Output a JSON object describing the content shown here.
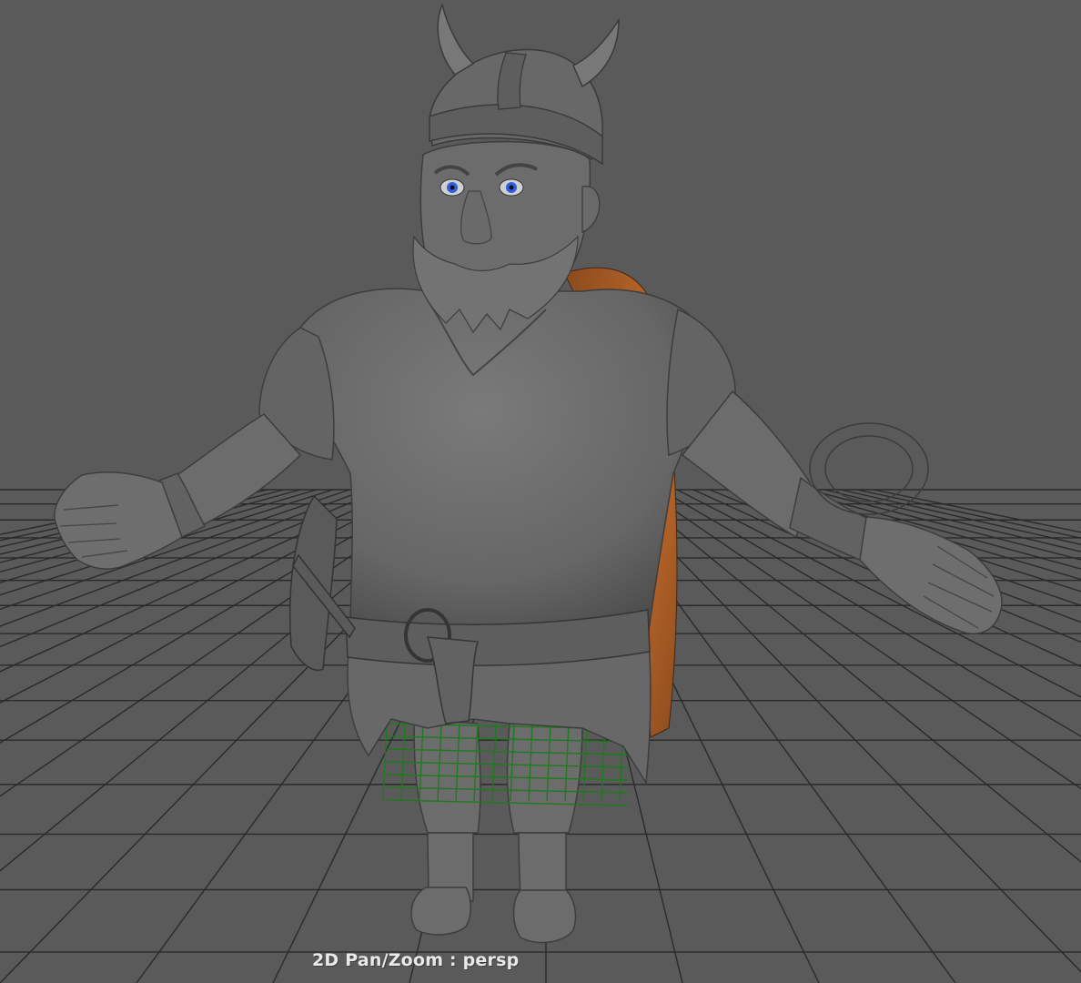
{
  "viewport": {
    "hud_label": "2D Pan/Zoom : persp",
    "background_color": "#5a5a5a",
    "grid_color": "#2a2a2a",
    "selection_wire_color": "#1f7a1f"
  },
  "model": {
    "eye_color": "#2f5fe0",
    "cape_color": "#c06a2a",
    "body_color": "#707070"
  }
}
